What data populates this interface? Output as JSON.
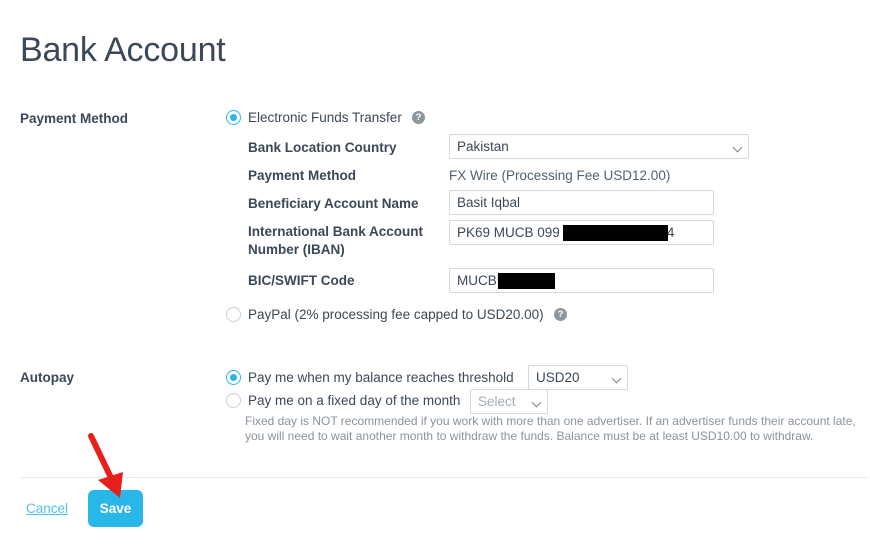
{
  "page": {
    "title": "Bank Account"
  },
  "payment_method_section": {
    "label": "Payment Method",
    "options": [
      {
        "id": "eft",
        "label": "Electronic Funds Transfer",
        "selected": true,
        "help_icon": "help-circle-icon"
      },
      {
        "id": "paypal",
        "label": "PayPal (2% processing fee capped to USD20.00)",
        "selected": false,
        "help_icon": "help-circle-icon"
      }
    ],
    "fields": {
      "bank_location_country": {
        "label": "Bank Location Country",
        "value": "Pakistan",
        "caret_icon": "chevron-down-icon"
      },
      "payment_method_value": {
        "label": "Payment Method",
        "value": "FX Wire (Processing Fee USD12.00)"
      },
      "beneficiary_account_name": {
        "label": "Beneficiary Account Name",
        "value": "Basit Iqbal"
      },
      "iban": {
        "label": "International Bank Account Number (IBAN)",
        "value_prefix": "PK69 MUCB 099",
        "value_suffix": "4"
      },
      "bic_swift": {
        "label": "BIC/SWIFT Code",
        "value_prefix": "MUCBP"
      }
    }
  },
  "autopay_section": {
    "label": "Autopay",
    "options": [
      {
        "id": "threshold",
        "label": "Pay me when my balance reaches threshold",
        "selected": true,
        "select_value": "USD20",
        "caret_icon": "chevron-down-icon"
      },
      {
        "id": "fixed-day",
        "label": "Pay me on a fixed day of the month",
        "selected": false,
        "select_placeholder": "Select",
        "caret_icon": "chevron-down-icon"
      }
    ],
    "fine_print": "Fixed day is NOT recommended if you work with more than one advertiser. If an advertiser funds their account late, you will need to wait another month to withdraw the funds. Balance must be at least USD10.00 to withdraw."
  },
  "footer": {
    "cancel_label": "Cancel",
    "save_label": "Save"
  },
  "annotation": {
    "arrow_icon": "red-arrow-pointing-to-save",
    "color": "#e8201c"
  },
  "colors": {
    "accent": "#29b6e8",
    "link": "#4ec3ee",
    "text": "#3c4858",
    "muted": "#8b939b",
    "border": "#d4d8dc",
    "annotation_red": "#e8201c"
  }
}
